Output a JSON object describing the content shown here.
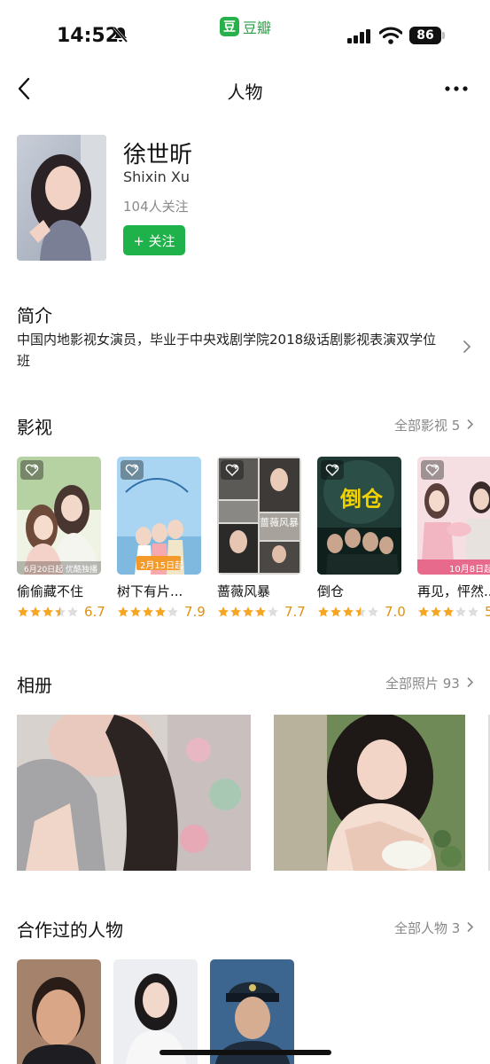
{
  "status_bar": {
    "time": "14:52",
    "app_logo": "豆",
    "app_name": "豆瓣",
    "battery": "86"
  },
  "nav": {
    "title": "人物"
  },
  "profile": {
    "name": "徐世昕",
    "name_en": "Shixin Xu",
    "followers": "104人关注",
    "follow_button": "+ 关注"
  },
  "intro": {
    "title": "简介",
    "text": "中国内地影视女演员，毕业于中央戏剧学院2018级话剧影视表演双学位班"
  },
  "works": {
    "title": "影视",
    "more": "全部影视 5",
    "items": [
      {
        "title": "偷偷藏不住",
        "score": "6.7",
        "stars": 3.5,
        "poster_text": "6月20日起 优酷独播"
      },
      {
        "title": "树下有片...",
        "score": "7.9",
        "stars": 4,
        "poster_text": "2月15日起"
      },
      {
        "title": "蔷薇风暴",
        "score": "7.7",
        "stars": 4,
        "poster_text": "蔷薇风暴"
      },
      {
        "title": "倒仓",
        "score": "7.0",
        "stars": 3.5,
        "poster_text": "倒仓"
      },
      {
        "title": "再见，怦然...",
        "score": "5",
        "stars": 3,
        "poster_text": "10月8日起"
      }
    ]
  },
  "album": {
    "title": "相册",
    "more": "全部照片 93"
  },
  "collaborators": {
    "title": "合作过的人物",
    "more": "全部人物 3"
  },
  "colors": {
    "brand_green": "#1fb24a",
    "star": "#f5a623",
    "score": "#e09015"
  }
}
